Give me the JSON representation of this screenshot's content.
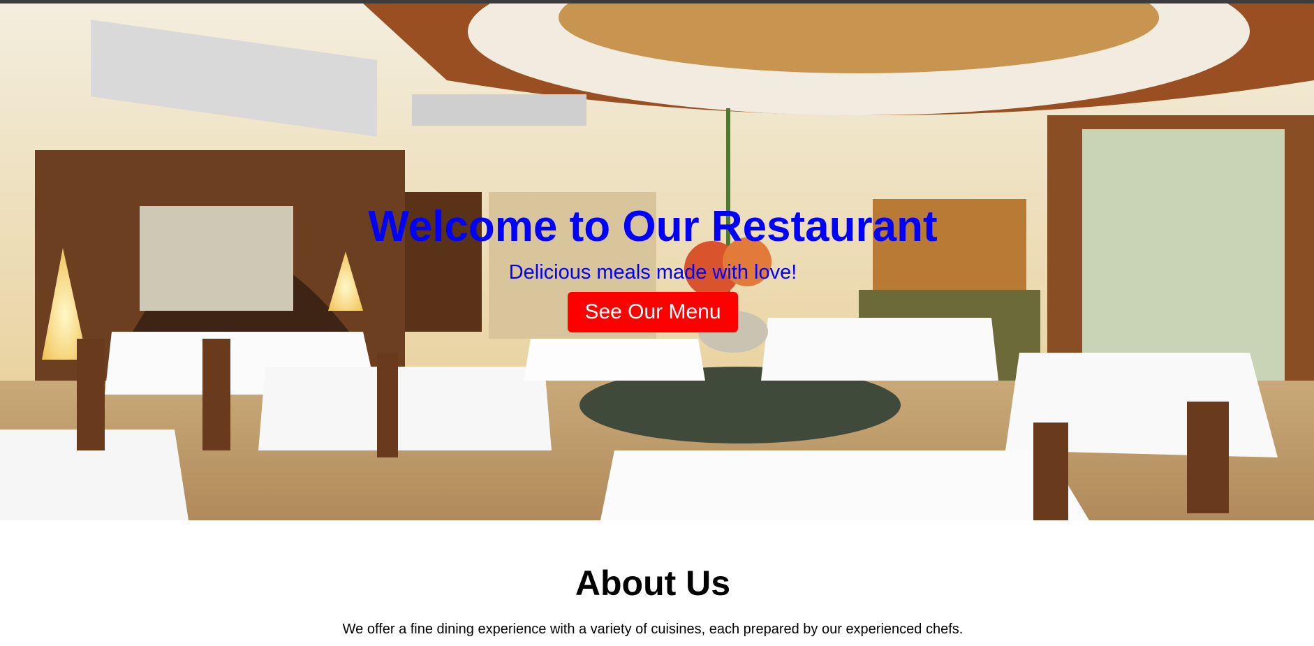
{
  "hero": {
    "title": "Welcome to Our Restaurant",
    "subtitle": "Delicious meals made with love!",
    "button_label": "See Our Menu",
    "background_image": "restaurant-dining-room-photo"
  },
  "about": {
    "title": "About Us",
    "text": "We offer a fine dining experience with a variety of cuisines, each prepared by our experienced chefs."
  },
  "colors": {
    "hero_text": "#0000ff",
    "button_background": "#ff0000",
    "button_text": "#ffffff"
  }
}
